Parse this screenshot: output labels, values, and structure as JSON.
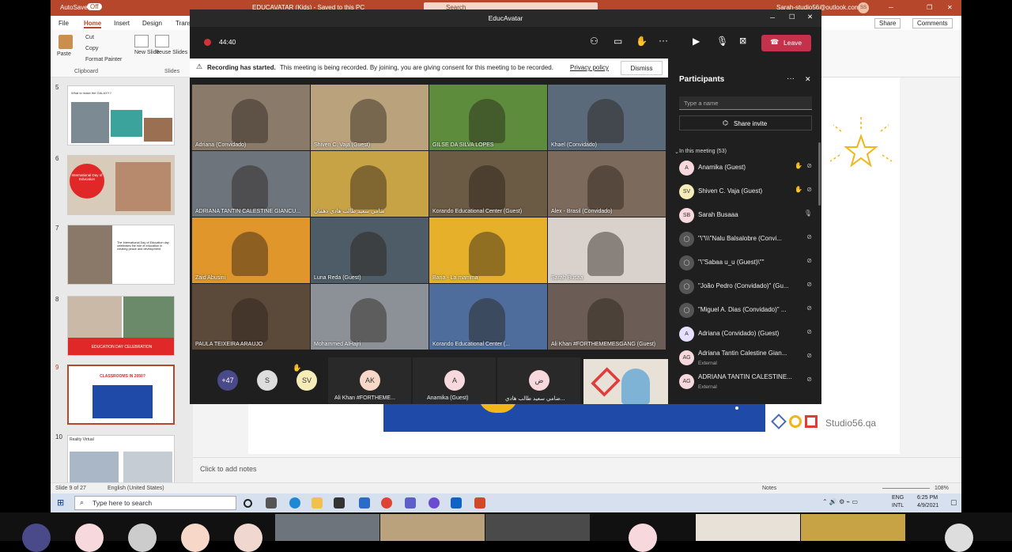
{
  "ppt": {
    "autosave_label": "AutoSave",
    "autosave_state": "Off",
    "doc_title": "EDUCAVATAR (Kids) - Saved to this PC",
    "search_placeholder": "Search",
    "account": "Sarah-studio56@outlook.com",
    "account_initials": "SS",
    "tabs": [
      "File",
      "Home",
      "Insert",
      "Design",
      "Trans"
    ],
    "share_label": "Share",
    "comments_label": "Comments",
    "ribbon": {
      "paste": "Paste",
      "cut": "Cut",
      "copy": "Copy",
      "format_painter": "Format Painter",
      "clipboard": "Clipboard",
      "new_slide": "New Slide",
      "reuse_slides": "Reuse Slides",
      "slides": "Slides"
    },
    "thumbnails": [
      {
        "num": "5",
        "text": "What to make the GALAXY?"
      },
      {
        "num": "6",
        "text": "International Day of Education"
      },
      {
        "num": "7",
        "text": "The International Day of Education day celebrates the role of education in creating peace and development."
      },
      {
        "num": "8",
        "text": "EDUCATION DAY CELEBRATION"
      },
      {
        "num": "9",
        "text": "CLASSROOMS IN 2050?"
      },
      {
        "num": "10",
        "text": "Reality Virtual"
      }
    ],
    "slide_brand": "Studio56.qa",
    "notes_placeholder": "Click to add notes",
    "status_slide": "Slide 9 of 27",
    "status_lang": "English (United States)",
    "status_notes": "Notes",
    "status_zoom": "108%",
    "taskbar": {
      "search_placeholder": "Type here to search",
      "lang": "ENG",
      "layout": "INTL",
      "time": "6:25 PM",
      "date": "4/9/2021"
    }
  },
  "teams": {
    "window_title": "EducAvatar",
    "timer": "44:40",
    "leave_label": "Leave",
    "banner": {
      "title": "Recording has started.",
      "text": "This meeting is being recorded. By joining, you are giving consent for this meeting to be recorded.",
      "link": "Privacy policy",
      "dismiss": "Dismiss"
    },
    "tiles": [
      {
        "name": "Adriana (Convidado)",
        "color": "#8a7a6a"
      },
      {
        "name": "Shiven C. Vaja (Guest)",
        "color": "#b9a27c"
      },
      {
        "name": "GILSE DA SILVA LOPES",
        "color": "#5c8c3c"
      },
      {
        "name": "Khael (Convidado)",
        "color": "#5a6a7a"
      },
      {
        "name": "ADRIANA TANTIN CALESTINE GIANCU...",
        "color": "#6d747c"
      },
      {
        "name": "ضامي سعيد طالب هادي دهمان",
        "color": "#c8a346"
      },
      {
        "name": "Korando Educational Center (Guest)",
        "color": "#6b5a44"
      },
      {
        "name": "Alex - Brasil (Convidado)",
        "color": "#7c6a5c"
      },
      {
        "name": "Zaid Abusini",
        "color": "#e0962a"
      },
      {
        "name": "Luna Reda (Guest)",
        "color": "#4d5c66"
      },
      {
        "name": "Baria - La mamma",
        "color": "#e6b02a"
      },
      {
        "name": "Sarah Busaa",
        "color": "#d9d2cc"
      },
      {
        "name": "PAULA TEIXEIRA ARAUJO",
        "color": "#5b4a3a"
      },
      {
        "name": "Mohammed AlHajri",
        "color": "#8b9197"
      },
      {
        "name": "Korando Educational Center (...",
        "color": "#4e6d9c"
      },
      {
        "name": "Ali Khan #FORTHEMEMESGANG (Guest)",
        "color": "#6b5d55"
      }
    ],
    "strip": {
      "more_count": "+47",
      "s_initial": "S",
      "sv_initials": "SV",
      "ak_initials": "AK",
      "ak_name": "Ali Khan #FORTHEME...",
      "a_initial": "A",
      "a_name": "Anamika (Guest)",
      "d_initial": "ض",
      "d_name": "ضامي سعيد طالب هادي..."
    },
    "participants": {
      "title": "Participants",
      "search_placeholder": "Type a name",
      "share_invite": "Share invite",
      "in_meeting": "In this meeting (53)",
      "list": [
        {
          "initials": "A",
          "name": "Anamika (Guest)",
          "sub": "",
          "hand": true
        },
        {
          "initials": "SV",
          "name": "Shiven C. Vaja (Guest)",
          "sub": "",
          "hand": true
        },
        {
          "initials": "SB",
          "name": "Sarah Busaaa",
          "sub": "",
          "hand": false
        },
        {
          "initials": "",
          "name": "\"\\\"\\\\\\\"Nalu Balsalobre (Convi...",
          "sub": "",
          "hand": false
        },
        {
          "initials": "",
          "name": "\"\\\"Sabaa u_u (Guest)\\\"\"",
          "sub": "",
          "hand": false
        },
        {
          "initials": "",
          "name": "\"João Pedro (Convidado)\" (Gu...",
          "sub": "",
          "hand": false
        },
        {
          "initials": "",
          "name": "\"Miguel A. Dias (Convidado)\" ...",
          "sub": "",
          "hand": false
        },
        {
          "initials": "A",
          "name": "Adriana (Convidado) (Guest)",
          "sub": "",
          "hand": false
        },
        {
          "initials": "AG",
          "name": "Adriana Tantin Calestine Gian...",
          "sub": "External",
          "hand": false
        },
        {
          "initials": "AG",
          "name": "ADRIANA TANTIN CALESTINE...",
          "sub": "External",
          "hand": false
        }
      ]
    }
  }
}
